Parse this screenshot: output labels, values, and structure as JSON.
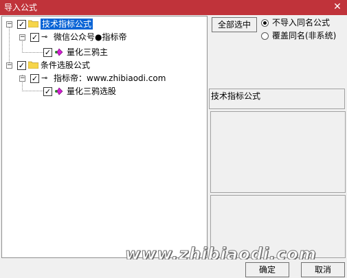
{
  "window": {
    "title": "导入公式"
  },
  "tree": {
    "nodes": [
      {
        "label": "技术指标公式",
        "checked": true,
        "expanded": true,
        "selected": true
      },
      {
        "label": "微信公众号●指标帝",
        "checked": true,
        "expanded": true
      },
      {
        "label": "量化三鸦主",
        "checked": true
      },
      {
        "label": "条件选股公式",
        "checked": true,
        "expanded": true
      },
      {
        "label": "指标帝：www.zhibiaodi.com",
        "checked": true,
        "expanded": true
      },
      {
        "label": "量化三鸦选股",
        "checked": true
      }
    ]
  },
  "options": {
    "select_all_label": "全部选中",
    "radio_skip_label": "不导入同名公式",
    "radio_overwrite_label": "覆盖同名(非系统)",
    "selected_radio": "skip"
  },
  "info": {
    "category_text": "技术指标公式"
  },
  "footer": {
    "ok_label": "确定",
    "cancel_label": "取消"
  },
  "watermark": {
    "text": "www.zhibiaodi.com"
  },
  "colors": {
    "titlebar": "#c0333a",
    "selection": "#0a64d6"
  }
}
